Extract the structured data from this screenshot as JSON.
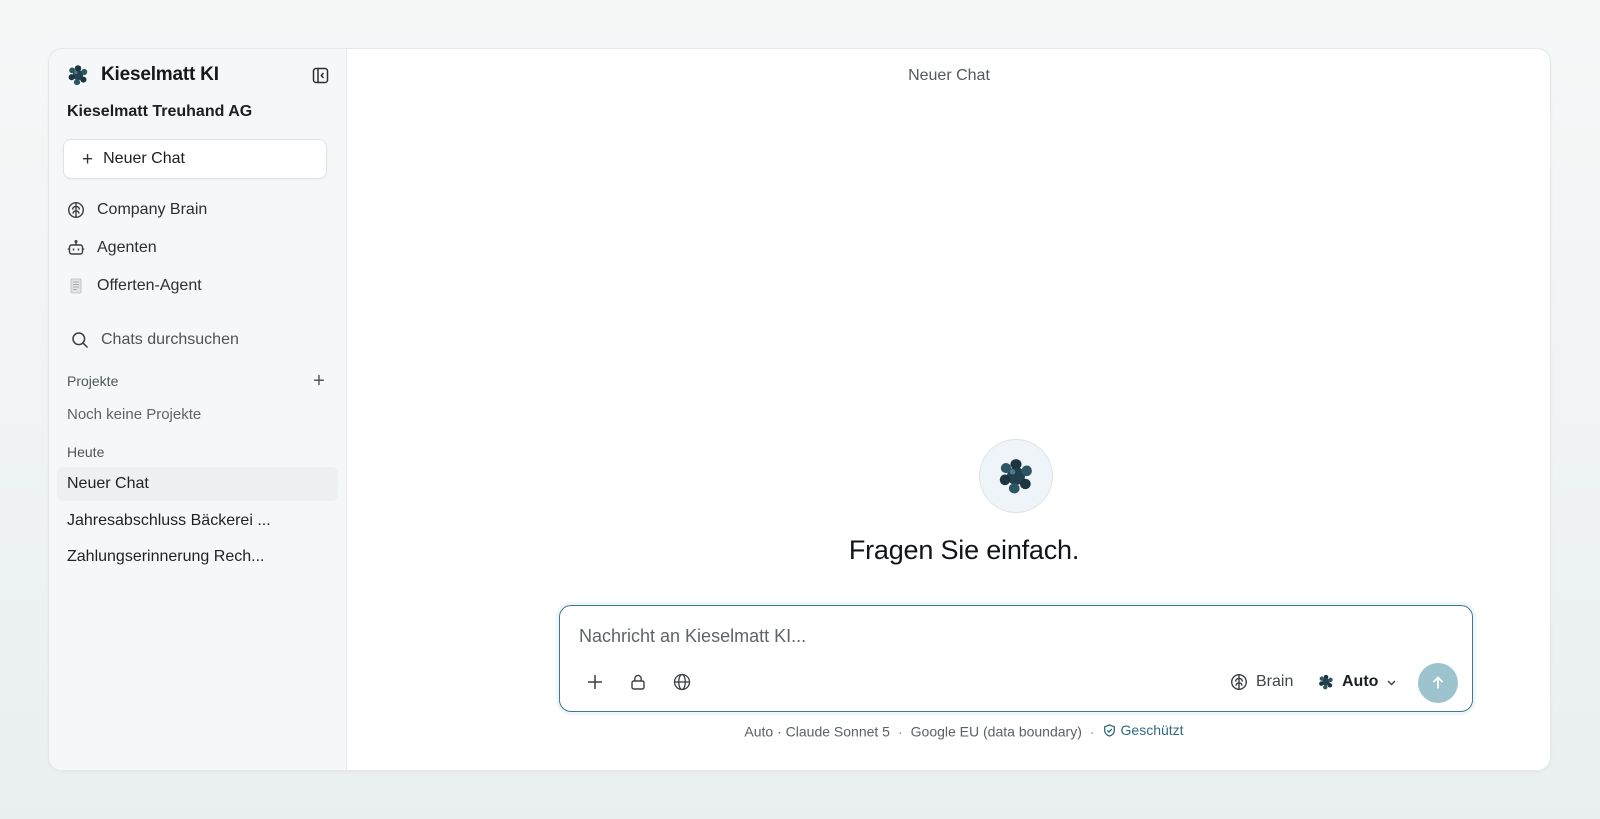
{
  "app": {
    "name": "Kieselmatt KI",
    "org_name": "Kieselmatt Treuhand AG",
    "accent_color": "#3d7a8e",
    "send_button_color": "#9dc3cf"
  },
  "sidebar": {
    "collapse_icon": "sidebar-collapse-icon",
    "new_chat_label": "Neuer Chat",
    "nav": [
      {
        "label": "Company Brain",
        "icon": "brain-icon"
      },
      {
        "label": "Agenten",
        "icon": "bot-icon"
      },
      {
        "label": "Offerten-Agent",
        "icon": "document-icon"
      }
    ],
    "search_label": "Chats durchsuchen",
    "projects_label": "Projekte",
    "projects_empty": "Noch keine Projekte",
    "today_label": "Heute",
    "chats": [
      {
        "title": "Neuer Chat",
        "active": true
      },
      {
        "title": "Jahresabschluss Bäckerei ..."
      },
      {
        "title": "Zahlungserinnerung Rech..."
      }
    ]
  },
  "main": {
    "header_title": "Neuer Chat",
    "hero_title": "Fragen Sie einfach."
  },
  "composer": {
    "placeholder": "Nachricht an Kieselmatt KI...",
    "value": "",
    "brain_label": "Brain",
    "model_label": "Auto"
  },
  "footer": {
    "model_info": "Auto · Claude Sonnet 5",
    "region": "Google EU (data boundary)",
    "secure_label": "Geschützt"
  }
}
